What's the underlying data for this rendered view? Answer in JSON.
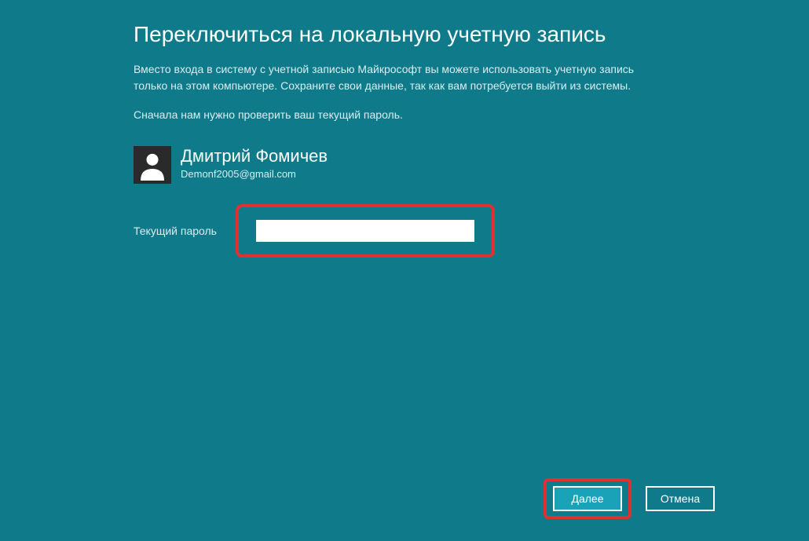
{
  "title": "Переключиться на локальную учетную запись",
  "description": "Вместо входа в систему с учетной записью Майкрософт вы можете использовать учетную запись только на этом компьютере. Сохраните свои данные, так как вам потребуется выйти из системы.",
  "verify_text": "Сначала нам нужно проверить ваш текущий пароль.",
  "user": {
    "name": "Дмитрий Фомичев",
    "email": "Demonf2005@gmail.com"
  },
  "password": {
    "label": "Текущий пароль",
    "value": ""
  },
  "buttons": {
    "next": "Далее",
    "cancel": "Отмена"
  },
  "colors": {
    "background": "#0e7a8a",
    "highlight": "#e03030",
    "button_primary": "#1aa3b8"
  }
}
